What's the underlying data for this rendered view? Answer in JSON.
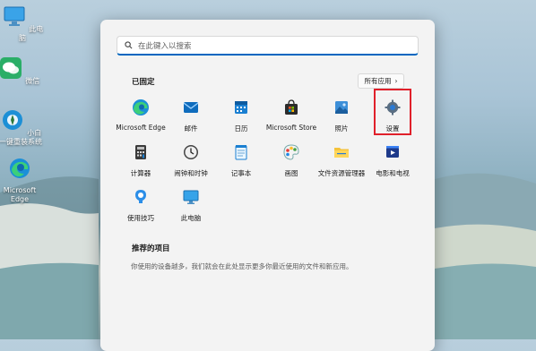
{
  "desktop": {
    "icons": [
      {
        "label": "此电脑"
      },
      {
        "label": "微信"
      },
      {
        "label": "小白一键重装系统"
      },
      {
        "label": "Microsoft Edge"
      }
    ]
  },
  "start_menu": {
    "search": {
      "placeholder": "在此键入以搜索"
    },
    "pinned": {
      "title": "已固定",
      "all_apps_label": "所有应用",
      "apps": [
        {
          "label": "Microsoft Edge",
          "icon": "edge-icon"
        },
        {
          "label": "邮件",
          "icon": "mail-icon"
        },
        {
          "label": "日历",
          "icon": "calendar-icon"
        },
        {
          "label": "Microsoft Store",
          "icon": "store-icon"
        },
        {
          "label": "照片",
          "icon": "photos-icon"
        },
        {
          "label": "设置",
          "icon": "settings-icon"
        },
        {
          "label": "计算器",
          "icon": "calculator-icon"
        },
        {
          "label": "闹钟和时钟",
          "icon": "clock-icon"
        },
        {
          "label": "记事本",
          "icon": "notepad-icon"
        },
        {
          "label": "画图",
          "icon": "paint-icon"
        },
        {
          "label": "文件资源管理器",
          "icon": "folder-icon"
        },
        {
          "label": "电影和电视",
          "icon": "movies-icon"
        },
        {
          "label": "使用技巧",
          "icon": "tips-icon"
        },
        {
          "label": "此电脑",
          "icon": "this-pc-icon"
        }
      ]
    },
    "recommended": {
      "title": "推荐的项目",
      "text": "你使用的设备越多，我们就会在此处显示更多你最近使用的文件和新应用。"
    },
    "highlight_color": "#e0202a"
  }
}
